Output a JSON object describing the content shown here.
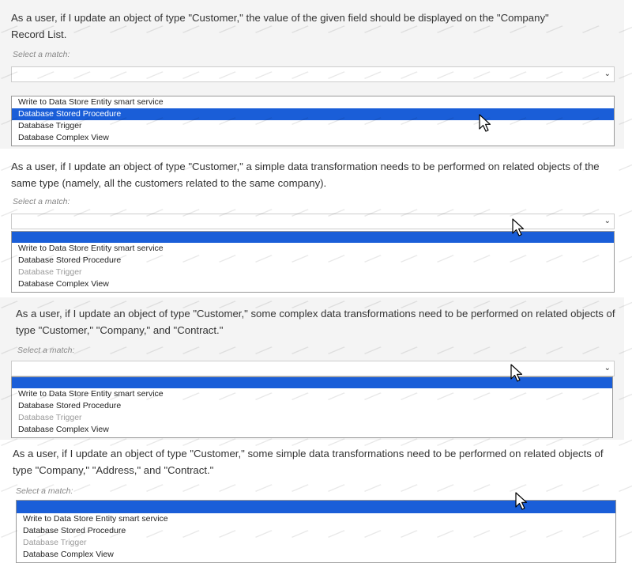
{
  "select_placeholder": "Select a match:",
  "questions": [
    {
      "text": "As a user, if I update an object of type \"Customer,\" the value of the given field should be displayed on the \"Company\" Record List.",
      "options": [
        "Write to Data Store Entity smart service",
        "Database Stored Procedure",
        "Database Trigger",
        "Database Complex View"
      ],
      "selected_index": 1,
      "disabled_indices": []
    },
    {
      "text": "As a user, if I update an object of type \"Customer,\" a simple data transformation needs to be performed on related objects of the same type (namely, all the customers related to the same company).",
      "options": [
        "Write to Data Store Entity smart service",
        "Database Stored Procedure",
        "Database Trigger",
        "Database Complex View"
      ],
      "selected_index": -1,
      "disabled_indices": [
        2
      ]
    },
    {
      "text": "As a user, if I update an object of type \"Customer,\" some complex data transformations need to be performed on related objects of type \"Customer,\" \"Company,\" and \"Contract.\"",
      "options": [
        "Write to Data Store Entity smart service",
        "Database Stored Procedure",
        "Database Trigger",
        "Database Complex View"
      ],
      "selected_index": -1,
      "disabled_indices": [
        2
      ]
    },
    {
      "text": "As a user, if I update an object of type \"Customer,\" some simple data transformations need to be performed on related objects of type \"Company,\" \"Address,\" and \"Contract.\"",
      "options": [
        "Write to Data Store Entity smart service",
        "Database Stored Procedure",
        "Database Trigger",
        "Database Complex View"
      ],
      "selected_index": -1,
      "disabled_indices": [
        2
      ]
    }
  ],
  "icons": {
    "dropdown": "chevron-down-icon",
    "cursor": "mouse-pointer-icon"
  },
  "colors": {
    "selection": "#1a5ed8",
    "shaded_background": "#f4f4f4"
  }
}
